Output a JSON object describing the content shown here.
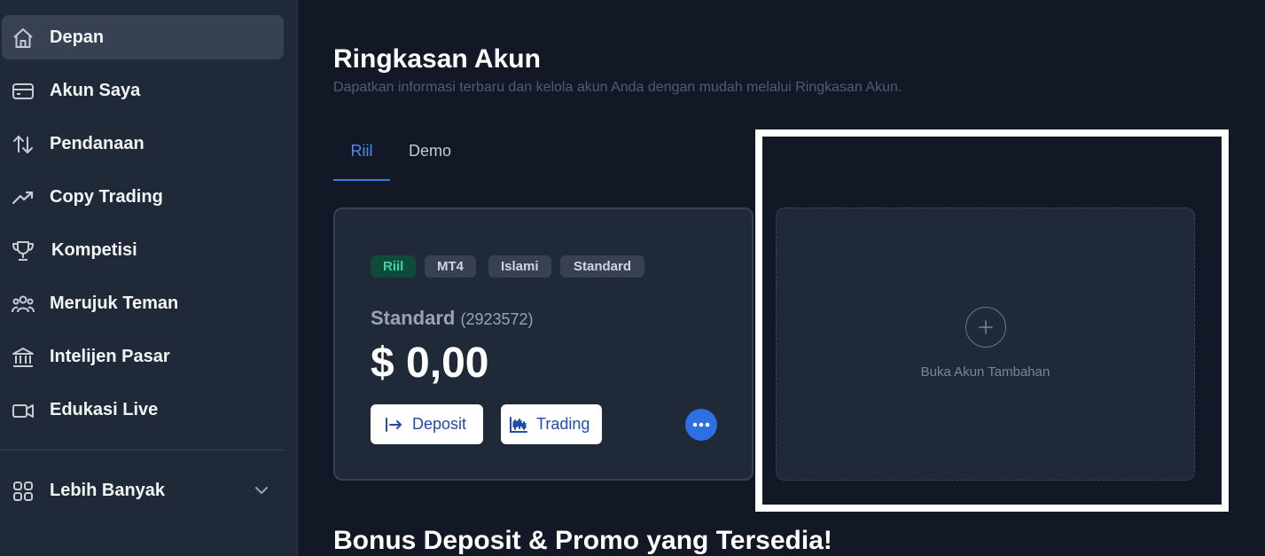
{
  "sidebar": {
    "items": [
      {
        "label": "Depan",
        "icon": "home-icon",
        "active": true
      },
      {
        "label": "Akun Saya",
        "icon": "wallet-icon"
      },
      {
        "label": "Pendanaan",
        "icon": "transfer-arrows-icon"
      },
      {
        "label": "Copy Trading",
        "icon": "trending-up-icon"
      },
      {
        "label": "Kompetisi",
        "icon": "trophy-icon"
      },
      {
        "label": "Merujuk Teman",
        "icon": "users-icon"
      },
      {
        "label": "Intelijen Pasar",
        "icon": "bank-icon"
      },
      {
        "label": "Edukasi Live",
        "icon": "video-icon"
      }
    ],
    "more": {
      "label": "Lebih Banyak",
      "icon": "grid-icon"
    }
  },
  "main": {
    "title": "Ringkasan Akun",
    "subtitle": "Dapatkan informasi terbaru dan kelola akun Anda dengan mudah melalui Ringkasan Akun.",
    "tabs": [
      {
        "label": "Riil",
        "active": true
      },
      {
        "label": "Demo",
        "active": false
      }
    ],
    "account_card": {
      "badges": [
        "Riil",
        "MT4",
        "Islami",
        "Standard"
      ],
      "name": "Standard",
      "number": "(2923572)",
      "balance": "$ 0,00",
      "deposit_label": "Deposit",
      "trading_label": "Trading"
    },
    "add_account": {
      "label": "Buka Akun Tambahan"
    },
    "promo_title": "Bonus Deposit & Promo yang Tersedia!"
  },
  "colors": {
    "background": "#121826",
    "sidebar": "#1f2937",
    "accent": "#3b7be8",
    "badge_green_text": "#3fd4a4"
  }
}
